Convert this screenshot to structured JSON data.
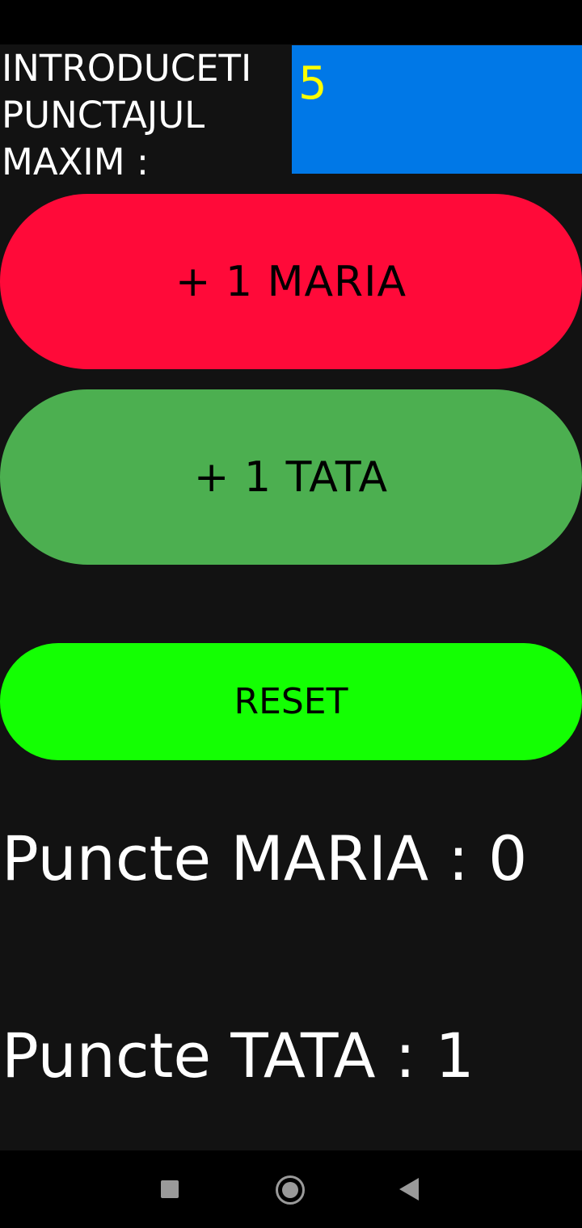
{
  "form": {
    "max_label": "INTRODUCETI\nPUNCTAJUL\nMAXIM :",
    "max_value": "5"
  },
  "buttons": {
    "maria": "+ 1 MARIA",
    "tata": "+ 1 TATA",
    "reset": "RESET"
  },
  "scores": {
    "maria": "Puncte MARIA : 0",
    "tata": "Puncte TATA : 1"
  },
  "colors": {
    "background": "#121212",
    "input_bg": "#0078e7",
    "input_text": "#ffff00",
    "maria_button": "#ff0a39",
    "tata_button": "#4caf50",
    "reset_button": "#14ff03"
  },
  "navigation": {
    "icons": [
      "recent-apps-icon",
      "home-icon",
      "back-icon"
    ]
  }
}
